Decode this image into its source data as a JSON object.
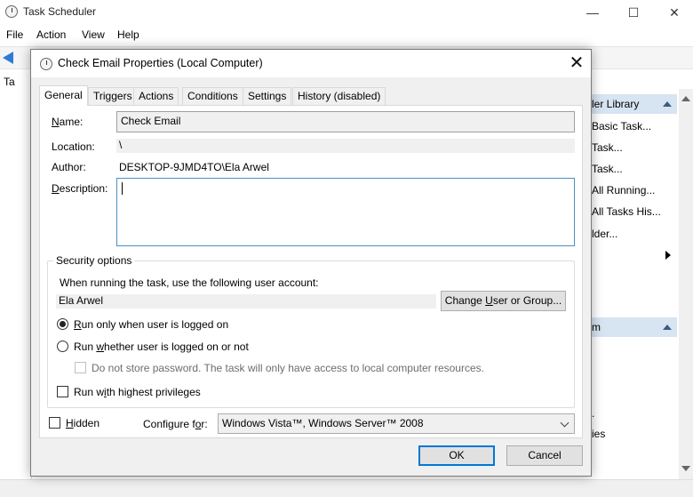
{
  "main_window": {
    "title": "Task Scheduler",
    "minimize": "—",
    "maximize": "☐",
    "close": "✕",
    "menu": [
      "File",
      "Action",
      "View",
      "Help"
    ],
    "tree_items": [
      "Ta",
      ""
    ],
    "actions": {
      "header1": "ler Library",
      "items": [
        "Basic Task...",
        "Task...",
        "Task...",
        "All Running...",
        "All Tasks His...",
        "lder..."
      ],
      "header2": "m",
      "items2": [
        ".",
        "ies"
      ]
    }
  },
  "dialog": {
    "title": "Check Email Properties (Local Computer)",
    "close": "✕",
    "tabs": [
      "General",
      "Triggers",
      "Actions",
      "Conditions",
      "Settings",
      "History (disabled)"
    ],
    "active_tab": "General",
    "name_label": "Name:",
    "name_value": "Check Email",
    "location_label": "Location:",
    "location_value": "\\",
    "author_label": "Author:",
    "author_value": "DESKTOP-9JMD4TO\\Ela Arwel",
    "description_label": "Description:",
    "description_value": "",
    "security": {
      "title": "Security options",
      "account_prompt": "When running the task, use the following user account:",
      "account_value": "Ela Arwel",
      "change_button": "Change User or Group...",
      "radio_logged_on": "Run only when user is logged on",
      "radio_logged_on_checked": true,
      "radio_whether": "Run whether user is logged on or not",
      "no_store_password": "Do not store password.  The task will only have access to local computer resources.",
      "highest_privileges": "Run with highest privileges"
    },
    "hidden_label": "Hidden",
    "configure_label": "Configure for:",
    "configure_value": "Windows Vista™, Windows Server™ 2008",
    "ok_button": "OK",
    "cancel_button": "Cancel"
  },
  "colors": {
    "accent": "#0078d7",
    "focus_border": "#4a90c2",
    "action_header": "#d7e4f2"
  }
}
